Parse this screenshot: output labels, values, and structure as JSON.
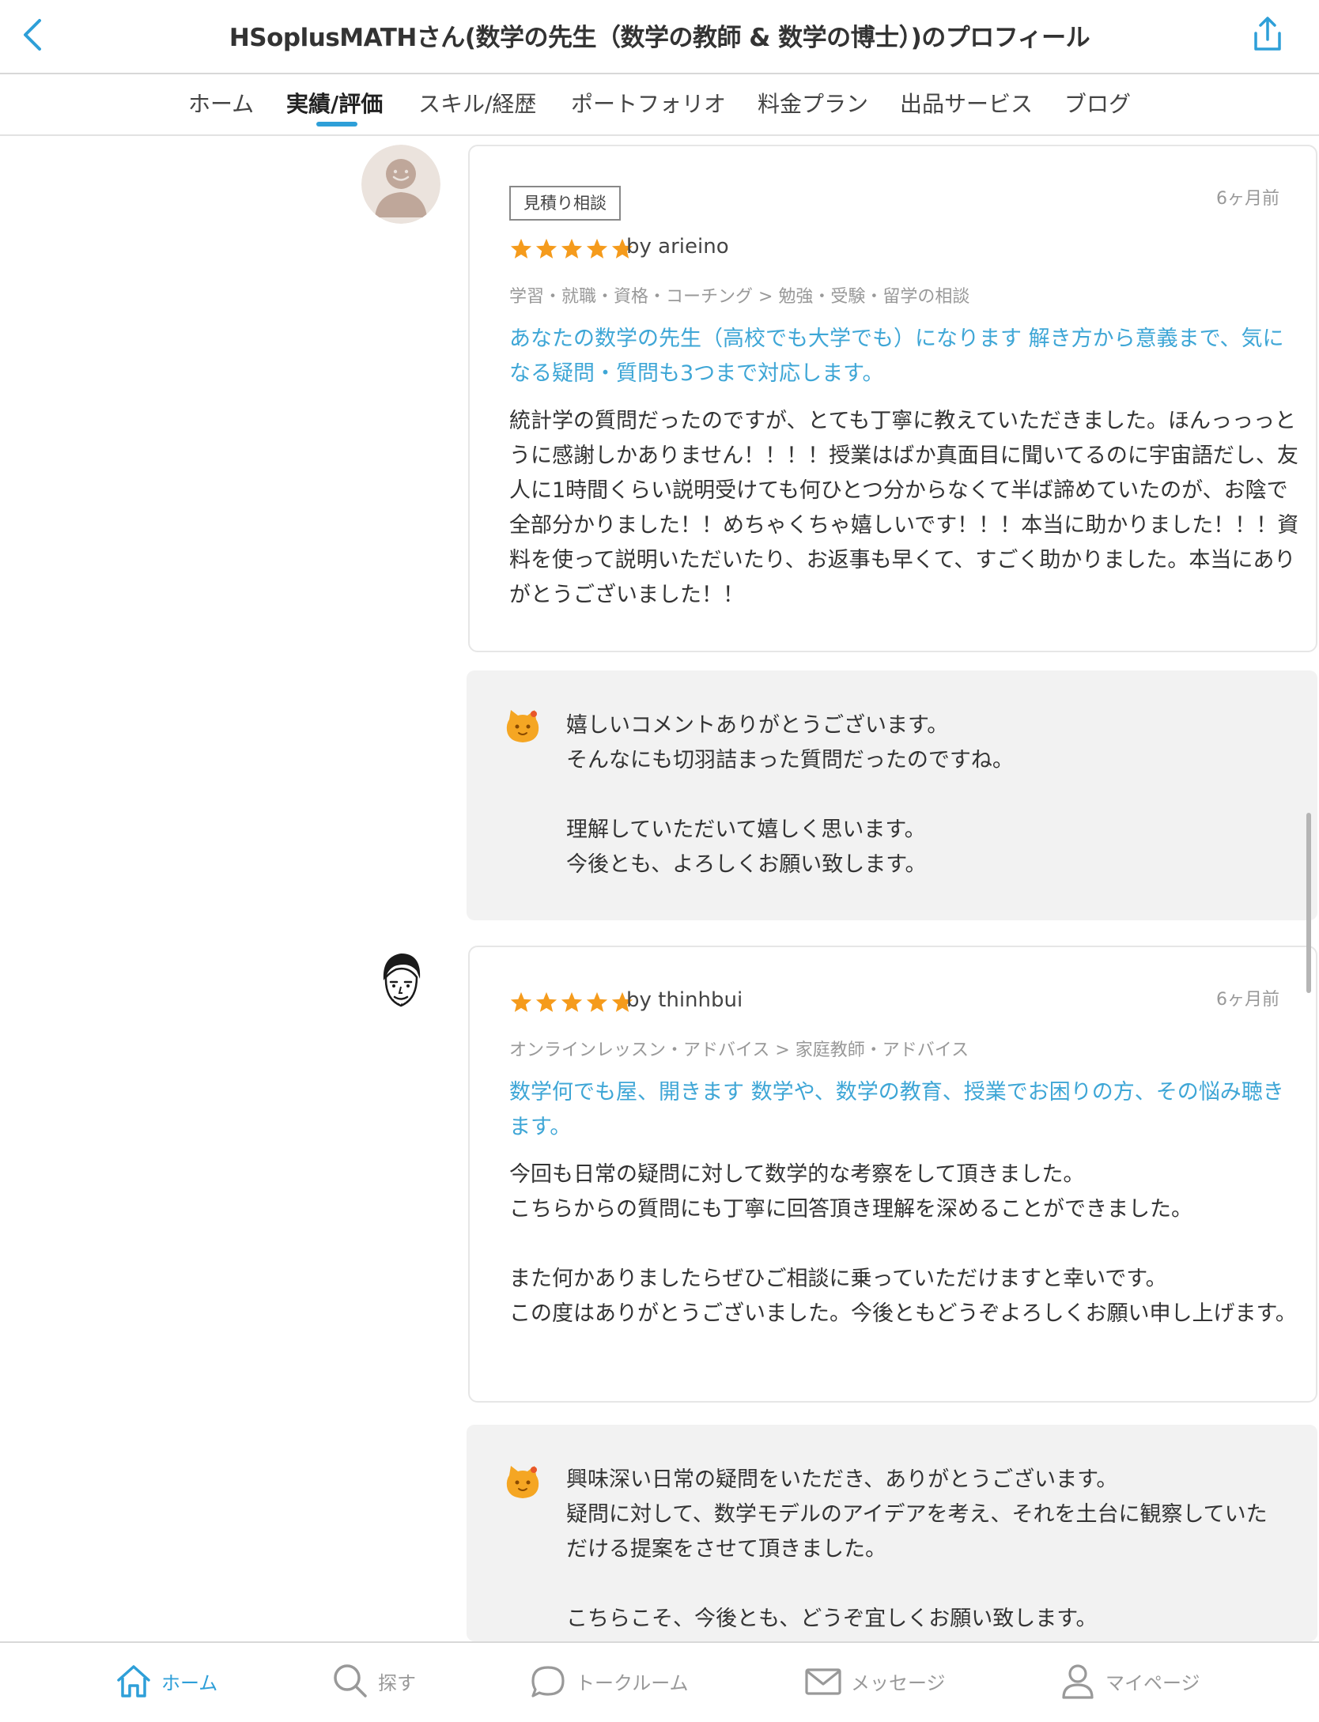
{
  "header": {
    "title": "HSoplusMATHさん(数学の先生（数学の教師 & 数学の博士）)のプロフィール"
  },
  "tabs": [
    {
      "label": "ホーム"
    },
    {
      "label": "実績/評価"
    },
    {
      "label": "スキル/経歴"
    },
    {
      "label": "ポートフォリオ"
    },
    {
      "label": "料金プラン"
    },
    {
      "label": "出品サービス"
    },
    {
      "label": "ブログ"
    }
  ],
  "active_tab": "実績/評価",
  "rating_stars": 5,
  "colors": {
    "accent": "#2e9fd8",
    "star": "#f59b1c",
    "service_link": "#3ea6d6",
    "reply_bg": "#f2f2f2"
  },
  "reviews": [
    {
      "badge": "見積り相談",
      "time": "6ヶ月前",
      "stars": 5,
      "by": "by arieino",
      "category": "学習・就職・資格・コーチング > 勉強・受験・留学の相談",
      "service": "あなたの数学の先生（高校でも大学でも）になります 解き方から意義まで、気になる疑問・質問も3つまで対応します。",
      "text": "統計学の質問だったのですが、とても丁寧に教えていただきました。ほんっっっとうに感謝しかありません！！！！授業はばか真面目に聞いてるのに宇宙語だし、友人に1時間くらい説明受けても何ひとつ分からなくて半ば諦めていたのが、お陰で全部分かりました！！めちゃくちゃ嬉しいです！！！本当に助かりました！！！資料を使って説明いただいたり、お返事も早くて、すごく助かりました。本当にありがとうございました！！",
      "reply": "嬉しいコメントありがとうございます。\nそんなにも切羽詰まった質問だったのですね。\n\n理解していただいて嬉しく思います。\n今後とも、よろしくお願い致します。"
    },
    {
      "time": "6ヶ月前",
      "stars": 5,
      "by": "by thinhbui",
      "category": "オンラインレッスン・アドバイス > 家庭教師・アドバイス",
      "service": "数学何でも屋、開きます 数学や、数学の教育、授業でお困りの方、その悩み聴きます。",
      "text": "今回も日常の疑問に対して数学的な考察をして頂きました。\nこちらからの質問にも丁寧に回答頂き理解を深めることができました。\n\nまた何かありましたらぜひご相談に乗っていただけますと幸いです。\nこの度はありがとうございました。今後ともどうぞよろしくお願い申し上げます。",
      "reply": "興味深い日常の疑問をいただき、ありがとうございます。\n疑問に対して、数学モデルのアイデアを考え、それを土台に観察していただける提案をさせて頂きました。\n\nこちらこそ、今後とも、どうぞ宜しくお願い致します。"
    }
  ],
  "bottom_nav": [
    {
      "label": "ホーム",
      "icon": "home-icon"
    },
    {
      "label": "探す",
      "icon": "search-icon"
    },
    {
      "label": "トークルーム",
      "icon": "chat-bubble-icon"
    },
    {
      "label": "メッセージ",
      "icon": "mail-icon"
    },
    {
      "label": "マイページ",
      "icon": "person-icon"
    }
  ]
}
